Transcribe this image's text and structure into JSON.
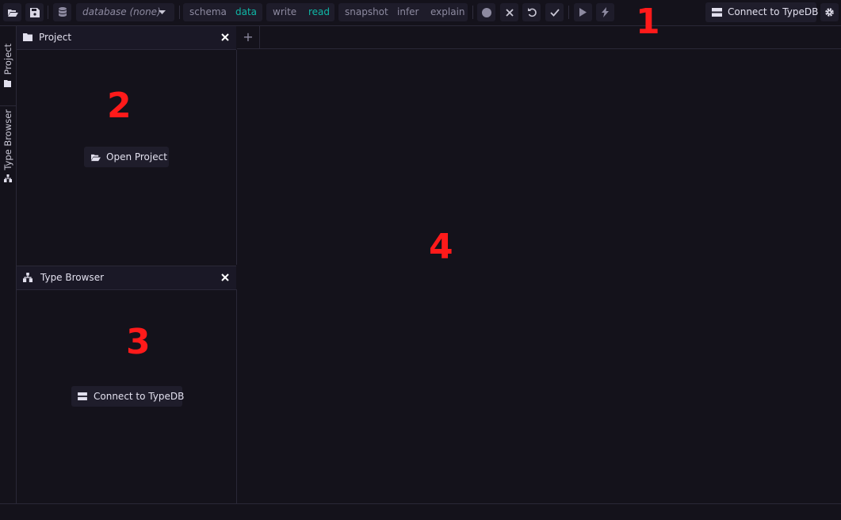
{
  "toolbar": {
    "database_selector": "database (none)",
    "session_type": {
      "schema": "schema",
      "data": "data"
    },
    "transaction_type": {
      "write": "write",
      "read": "read"
    },
    "options": {
      "snapshot": "snapshot",
      "infer": "infer",
      "explain": "explain"
    },
    "connect_label": "Connect to TypeDB"
  },
  "rail": {
    "project_tab": "Project",
    "type_browser_tab": "Type Browser"
  },
  "project_panel": {
    "title": "Project",
    "open_project_label": "Open Project"
  },
  "type_browser_panel": {
    "title": "Type Browser",
    "connect_label": "Connect to TypeDB"
  },
  "editor": {
    "new_tab_label": "+"
  },
  "annotations": {
    "toolbar": "1",
    "project": "2",
    "type_browser": "3",
    "editor": "4"
  },
  "colors": {
    "background": "#14121b",
    "accent": "#0fb7a6",
    "annotation": "#ff1a1a"
  }
}
